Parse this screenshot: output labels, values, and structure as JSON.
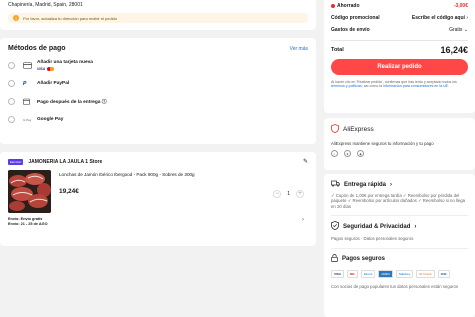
{
  "address": {
    "line": "Chapinería, Madrid, Spain, 28001",
    "warning": "Por favor, actualiza tu dirección para recibir el pedido"
  },
  "payment": {
    "title": "Métodos de pago",
    "see_more": "Ver más",
    "methods": [
      {
        "label": "Añadir una tarjeta nueva",
        "icon": "credit-card-icon"
      },
      {
        "label": "Añadir PayPal",
        "icon": "paypal-icon"
      },
      {
        "label": "Pago después de la entrega ⓘ",
        "icon": "calendar-icon"
      },
      {
        "label": "Google Pay",
        "icon": "google-pay-icon"
      }
    ],
    "card_brand": "VISA",
    "gpay_badge": "G Pay"
  },
  "store": {
    "badge": "Elección",
    "name": "JAMONERIA LA JAULA 1 Store",
    "product": {
      "title": "Lonchas de Jamón Ibérico Ibergood - Pack 900g - Sobres de 300g",
      "price": "19,24€",
      "quantity": "1",
      "minus": "−",
      "plus": "+"
    },
    "shipping_line1": "Envío: Envío gratis",
    "shipping_line2": "Envío: 21 - 25 de AGO"
  },
  "summary": {
    "saved_label": "Ahorrado",
    "saved_value": "-3,00€",
    "promo_label": "Código promocional",
    "promo_value": "Escribe el código aquí",
    "shipping_label": "Gastos de envío",
    "shipping_value": "Gratis",
    "total_label": "Total",
    "total_value": "16,24€",
    "place_order": "Realizar pedido",
    "legal_prefix": "Al hacer clic en 'Realizar pedido', confirmas que has leído y aceptado todos los ",
    "legal_link1": "términos y políticas",
    "legal_mid": ", así como la ",
    "legal_link2": "información para consumidores en la UE",
    "legal_suffix": "."
  },
  "aliexpress": {
    "name": "AliExpress",
    "description": "AliExpress mantiene seguros tu información y tu pago"
  },
  "trust": {
    "fast_title": "Entrega rápida",
    "fast_desc": "✓ Cupón de 1,00€ por entrega tardía  ✓ Reembolso por pérdida del paquete  ✓ Reembolso por artículos dañados  ✓ Reembolso si no llega en 20 días",
    "privacy_title": "Seguridad & Privacidad",
    "privacy_desc": "Pagos seguros · Datos personales seguros",
    "secure_title": "Pagos seguros",
    "secure_desc": "Con socios de pago populares tus datos personales están seguros",
    "logos": [
      "VISA",
      "MC",
      "Diners",
      "AMEX",
      "SafeKey",
      "ID Check",
      "JCB"
    ]
  },
  "colors": {
    "accent": "#ff4747",
    "link": "#1a6fd6",
    "saving": "#e62e2e"
  }
}
